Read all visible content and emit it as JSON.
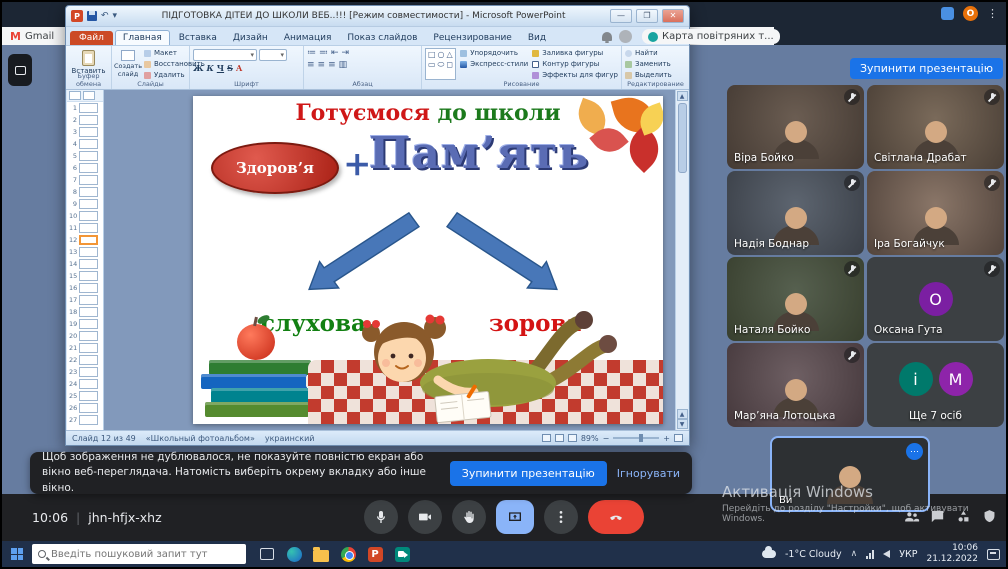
{
  "browser": {
    "bookmarks_gmail": "Gmail",
    "bookmark_map": "Карта повітряних т...",
    "profile_initial": "О"
  },
  "meet": {
    "stop_presentation": "Зупинити презентацію",
    "toast_message": "Щоб зображення не дублювалося, не показуйте повністю екран або вікно веб-переглядача. Натомість виберіть окрему вкладку або інше вікно.",
    "toast_primary": "Зупинити презентацію",
    "toast_secondary": "Ігнорувати",
    "time": "10:06",
    "meeting_code": "jhn-hfjx-xhz",
    "controls": [
      "microphone",
      "camera",
      "raise-hand",
      "present",
      "more-options",
      "end-call"
    ],
    "participants": [
      {
        "name": "Віра Бойко"
      },
      {
        "name": "Світлана Драбат"
      },
      {
        "name": "Надія Боднар"
      },
      {
        "name": "Іра Богайчук"
      },
      {
        "name": "Наталя Бойко"
      },
      {
        "name": "Оксана Гута",
        "initial": "О"
      },
      {
        "name": "Мар’яна Лотоцька"
      },
      {
        "name": "Ще 7 осіб",
        "initials": [
          "і",
          "М"
        ]
      }
    ],
    "self_label": "Ви"
  },
  "ppt": {
    "title": "ПІДГОТОВКА ДІТЕЙ ДО ШКОЛИ ВЕБ..!!! [Режим совместимости] - Microsoft PowerPoint",
    "tabs": [
      "Файл",
      "Главная",
      "Вставка",
      "Дизайн",
      "Анимация",
      "Показ слайдов",
      "Рецензирование",
      "Вид"
    ],
    "ribbon": {
      "paste": "Вставить",
      "clipboard_label": "Буфер обмена",
      "new_slide": "Создать слайд",
      "layout": "Макет",
      "reset": "Восстановить",
      "delete": "Удалить",
      "slides_label": "Слайды",
      "font_label": "Шрифт",
      "paragraph_label": "Абзац",
      "arrange": "Упорядочить",
      "quick_styles": "Экспресс-стили",
      "shape_fill": "Заливка фигуры",
      "shape_outline": "Контур фигуры",
      "shape_effects": "Эффекты для фигур",
      "drawing_label": "Рисование",
      "find": "Найти",
      "replace": "Заменить",
      "select": "Выделить",
      "editing_label": "Редактирование"
    },
    "thumbnails": {
      "count": 27,
      "selected": 12
    },
    "status": {
      "slide": "Слайд 12 из 49",
      "theme": "«Школьный фотоальбом»",
      "language": "украинский",
      "zoom": "89%"
    },
    "slide": {
      "title_red": "Готуємося ",
      "title_green": "до школи",
      "oval": "Здоров’я",
      "plus": "+",
      "memory": "Пам’ять",
      "left": "слухова",
      "right": "зорова"
    }
  },
  "activation": {
    "line1": "Активація Windows",
    "line2": "Перейдіть до розділу \"Настройки\", щоб активувати Windows."
  },
  "taskbar": {
    "search_placeholder": "Введіть пошуковий запит тут",
    "weather": "-1°C Cloudy",
    "lang": "УКР",
    "time": "10:06",
    "date": "21.12.2022"
  }
}
